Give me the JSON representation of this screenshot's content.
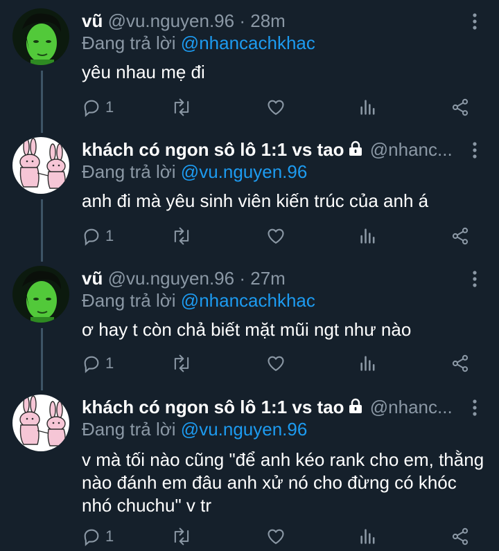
{
  "tweets": [
    {
      "name": "vũ",
      "handle": "@vu.nguyen.96",
      "separator": "·",
      "time": "28m",
      "reply_prefix": "Đang trả lời",
      "reply_to": "@nhancachkhac",
      "text": "yêu nhau mẹ đi",
      "reply_count": "1",
      "avatar": "green-face-avatar",
      "locked": false
    },
    {
      "name": "khách có ngon sô lô 1:1 vs tao",
      "handle": "@nhanc...",
      "reply_prefix": "Đang trả lời",
      "reply_to": "@vu.nguyen.96",
      "text": "anh đi mà yêu sinh viên kiến trúc của anh á",
      "reply_count": "1",
      "avatar": "pink-rabbits-avatar",
      "locked": true
    },
    {
      "name": "vũ",
      "handle": "@vu.nguyen.96",
      "separator": "·",
      "time": "27m",
      "reply_prefix": "Đang trả lời",
      "reply_to": "@nhancachkhac",
      "text": "ơ hay t còn chả biết mặt mũi ngt như nào",
      "reply_count": "1",
      "avatar": "green-face-avatar",
      "locked": false
    },
    {
      "name": "khách có ngon sô lô 1:1 vs tao",
      "handle": "@nhanc...",
      "reply_prefix": "Đang trả lời",
      "reply_to": "@vu.nguyen.96",
      "text": "v mà tối nào cũng \"để anh kéo rank cho em, thằng nào đánh em đâu anh xử nó cho đừng có khóc nhó chuchu\" v tr",
      "reply_count": "1",
      "avatar": "pink-rabbits-avatar",
      "locked": true
    }
  ],
  "colors": {
    "background": "#15202b",
    "text": "#ffffff",
    "secondary": "#8b98a5",
    "mention": "#1d9bf0",
    "thread_line": "#3d5466"
  },
  "icons": [
    "reply-icon",
    "retweet-icon",
    "like-icon",
    "analytics-icon",
    "share-icon",
    "more-icon",
    "lock-icon"
  ]
}
